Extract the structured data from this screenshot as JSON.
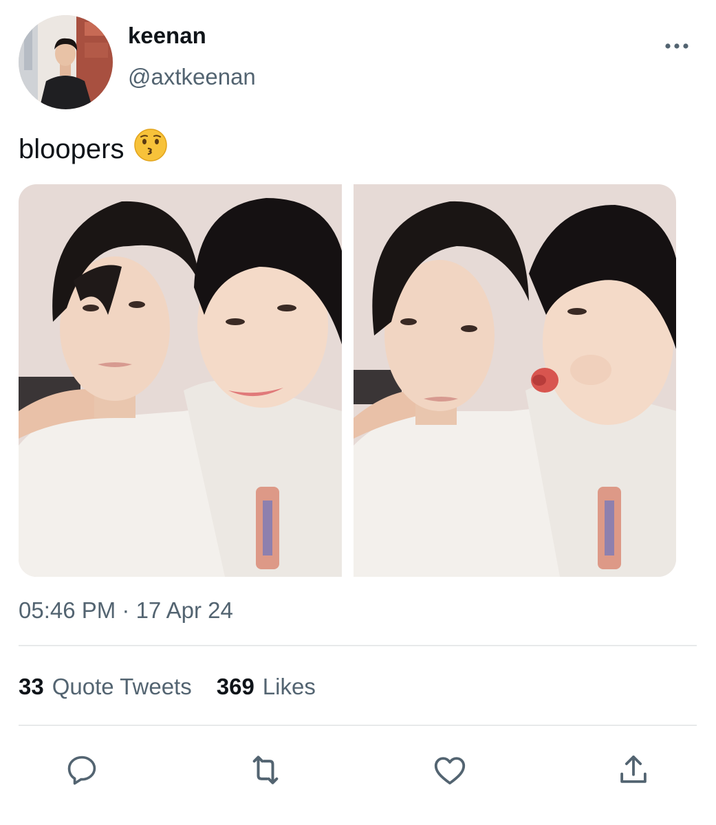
{
  "author": {
    "name": "keenan",
    "handle": "@axtkeenan"
  },
  "tweet": {
    "text": "bloopers",
    "emoji": "kissing-face-emoji",
    "timestamp": "05:46 PM · 17 Apr 24"
  },
  "media": [
    {
      "name": "photo-smiling"
    },
    {
      "name": "photo-kissing"
    }
  ],
  "stats": {
    "quote_tweets_count": "33",
    "quote_tweets_label": "Quote Tweets",
    "likes_count": "369",
    "likes_label": "Likes"
  },
  "actions": [
    "reply-icon",
    "retweet-icon",
    "like-icon",
    "share-icon"
  ],
  "colors": {
    "text": "#0f1419",
    "secondary": "#536471",
    "divider": "#e7e9ea",
    "background": "#ffffff"
  }
}
